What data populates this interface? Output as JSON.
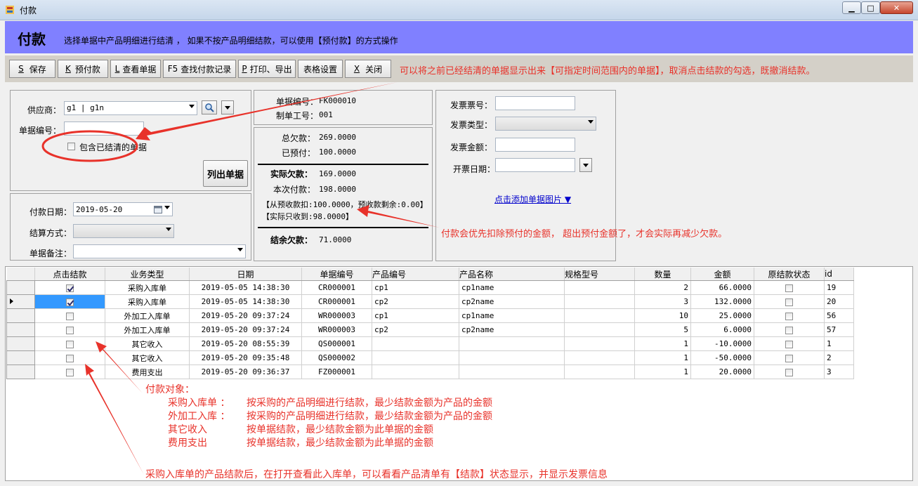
{
  "window": {
    "title": "付款"
  },
  "header": {
    "title": "付款",
    "subtitle": "选择单据中产品明细进行结清 ， 如果不按产品明细结款，可以使用【预付款】的方式操作"
  },
  "toolbar": {
    "buttons": [
      {
        "key": "S",
        "label": "保存"
      },
      {
        "key": "K",
        "label": "预付款"
      },
      {
        "key": "L",
        "label": "查看单据"
      },
      {
        "key": "F5",
        "label": "查找付款记录"
      },
      {
        "key": "P",
        "label": "打印、导出"
      },
      {
        "key": "",
        "label": "表格设置"
      },
      {
        "key": "X",
        "label": "关闭"
      }
    ],
    "note": "可以将之前已经结清的单据显示出来【可指定时间范围内的单据】，取消点击结款的勾选，既撤消结款。"
  },
  "filter": {
    "supplier_label": "供应商：",
    "supplier_value": "g1 | g1n",
    "doc_no_label": "单据编号：",
    "doc_no_value": "",
    "include_settled_label": "包含已结清的单据",
    "list_button": "列出单据"
  },
  "payment": {
    "date_label": "付款日期：",
    "date_value": "2019-05-20",
    "method_label": "结算方式：",
    "method_value": "",
    "remark_label": "单据备注：",
    "remark_value": ""
  },
  "doc_info": {
    "doc_no_label": "单据编号：",
    "doc_no_value": "FK000010",
    "operator_label": "制单工号：",
    "operator_value": "001"
  },
  "summary": {
    "total_owed_label": "总欠款：",
    "total_owed_value": "269.0000",
    "prepaid_label": "已预付：",
    "prepaid_value": "100.0000",
    "actual_owed_label": "实际欠款：",
    "actual_owed_value": "169.0000",
    "this_payment_label": "本次付款：",
    "this_payment_value": "198.0000",
    "deduct_line": "【从预收款扣:100.0000，预收款剩余:0.00】",
    "actual_received_line": "【实际只收到:98.0000】",
    "balance_label": "结余欠款：",
    "balance_value": "71.0000",
    "note": "付款会优先扣除预付的金额， 超出预付金额了，才会实际再减少欠款。"
  },
  "invoice": {
    "no_label": "发票票号：",
    "type_label": "发票类型：",
    "amount_label": "发票金额：",
    "date_label": "开票日期：",
    "add_image_link": "点击添加单据图片 ▼"
  },
  "grid": {
    "columns": [
      "点击结款",
      "业务类型",
      "日期",
      "单据编号",
      "产品编号",
      "产品名称",
      "规格型号",
      "数量",
      "金额",
      "原结款状态",
      "id"
    ],
    "rows": [
      {
        "checked": true,
        "type": "采购入库单",
        "date": "2019-05-05 14:38:30",
        "doc_no": "CR000001",
        "product_no": "cp1",
        "product_name": "cp1name",
        "spec": "",
        "qty": "2",
        "amount": "66.0000",
        "orig_status": false,
        "id": "19",
        "current": false
      },
      {
        "checked": true,
        "type": "采购入库单",
        "date": "2019-05-05 14:38:30",
        "doc_no": "CR000001",
        "product_no": "cp2",
        "product_name": "cp2name",
        "spec": "",
        "qty": "3",
        "amount": "132.0000",
        "orig_status": false,
        "id": "20",
        "current": true
      },
      {
        "checked": false,
        "type": "外加工入库单",
        "date": "2019-05-20 09:37:24",
        "doc_no": "WR000003",
        "product_no": "cp1",
        "product_name": "cp1name",
        "spec": "",
        "qty": "10",
        "amount": "25.0000",
        "orig_status": false,
        "id": "56",
        "current": false
      },
      {
        "checked": false,
        "type": "外加工入库单",
        "date": "2019-05-20 09:37:24",
        "doc_no": "WR000003",
        "product_no": "cp2",
        "product_name": "cp2name",
        "spec": "",
        "qty": "5",
        "amount": "6.0000",
        "orig_status": false,
        "id": "57",
        "current": false
      },
      {
        "checked": false,
        "type": "其它收入",
        "date": "2019-05-20 08:55:39",
        "doc_no": "QS000001",
        "product_no": "",
        "product_name": "",
        "spec": "",
        "qty": "1",
        "amount": "-10.0000",
        "orig_status": false,
        "id": "1",
        "current": false
      },
      {
        "checked": false,
        "type": "其它收入",
        "date": "2019-05-20 09:35:48",
        "doc_no": "QS000002",
        "product_no": "",
        "product_name": "",
        "spec": "",
        "qty": "1",
        "amount": "-50.0000",
        "orig_status": false,
        "id": "2",
        "current": false
      },
      {
        "checked": false,
        "type": "费用支出",
        "date": "2019-05-20 09:36:37",
        "doc_no": "FZ000001",
        "product_no": "",
        "product_name": "",
        "spec": "",
        "qty": "1",
        "amount": "20.0000",
        "orig_status": false,
        "id": "3",
        "current": false
      }
    ]
  },
  "notes": {
    "payment_target_title": "付款对象：",
    "target_lines": [
      {
        "name": "采购入库单 ：",
        "desc": "按采购的产品明细进行结款，最少结款金额为产品的金额"
      },
      {
        "name": "外加工入库 ：",
        "desc": "按采购的产品明细进行结款，最少结款金额为产品的金额"
      },
      {
        "name": "其它收入",
        "desc": "按单据结款，最少结款金额为此单据的金额"
      },
      {
        "name": "费用支出",
        "desc": "按单据结款，最少结款金额为此单据的金额"
      }
    ],
    "bottom_note": "采购入库单的产品结款后，在打开查看此入库单，可以看看产品清单有【结款】状态显示，并显示发票信息"
  },
  "colors": {
    "header_bg": "#8080ff",
    "annotation": "#e8322a",
    "link": "#0000cc"
  }
}
